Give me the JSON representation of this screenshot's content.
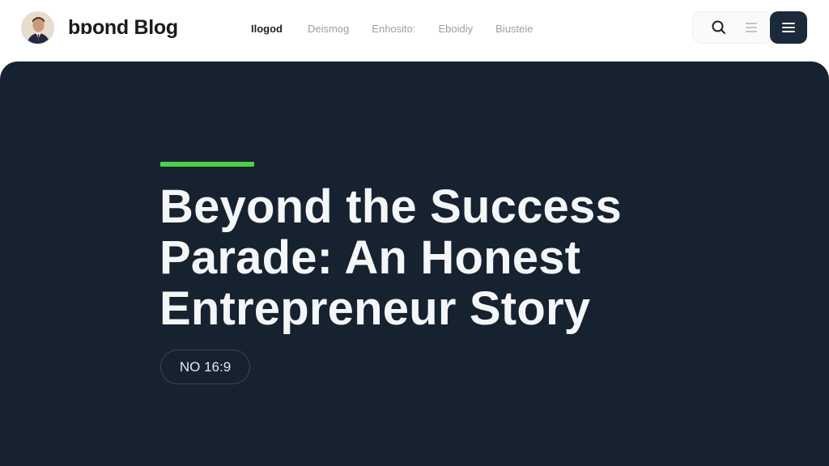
{
  "header": {
    "brand_name": "bɒond Blog",
    "nav": [
      {
        "label": "Ilogod",
        "active": true
      },
      {
        "label": "Deismog",
        "active": false
      },
      {
        "label": "Enhosito:",
        "active": false
      },
      {
        "label": "Eboidiy",
        "active": false
      },
      {
        "label": "Biusteie",
        "active": false
      }
    ]
  },
  "hero": {
    "headline": "Beyond the Success Parade: An Honest Entrepreneur Story",
    "badge": "NO 16:9"
  },
  "icons": {
    "search": "search-icon",
    "list": "list-icon",
    "menu": "hamburger-menu-icon",
    "avatar": "author-avatar"
  },
  "colors": {
    "hero_bg": "#172230",
    "accent": "#4cd14a",
    "menu_button": "#1b2a3a"
  }
}
